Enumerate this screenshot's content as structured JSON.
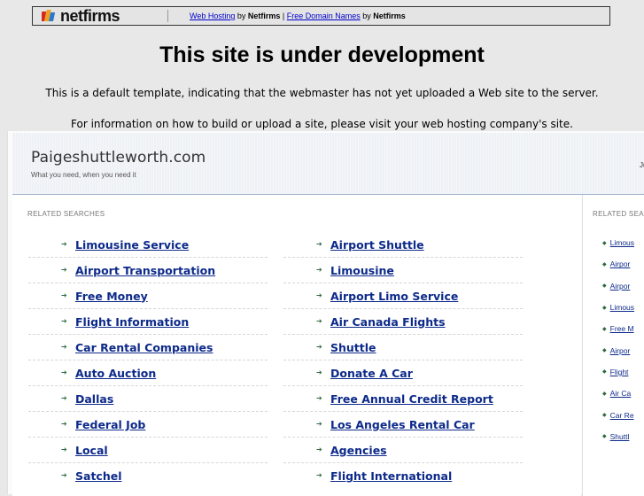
{
  "netfirms_bar": {
    "logo_text": "netfirms",
    "link1": "Web Hosting",
    "by1": " by ",
    "brand1": "Netfirms",
    "separator": " | ",
    "link2": "Free Domain Names",
    "by2": " by ",
    "brand2": "Netfirms"
  },
  "notice": {
    "title": "This site is under development",
    "line1": "This is a default template, indicating that the webmaster has not yet uploaded a Web site to the server.",
    "line2": "For information on how to build or upload a site, please visit your web hosting company's site."
  },
  "site": {
    "name": "Paigeshuttleworth.com",
    "tagline": "What you need, when you need it",
    "header_right": "Ju"
  },
  "main": {
    "section_label": "RELATED SEARCHES",
    "left_links": [
      "Limousine Service",
      "Airport Transportation",
      "Free Money",
      "Flight Information",
      "Car Rental Companies",
      "Auto Auction",
      "Dallas",
      "Federal Job",
      "Local",
      "Satchel"
    ],
    "right_links": [
      "Airport Shuttle",
      "Limousine",
      "Airport Limo Service",
      "Air Canada Flights",
      "Shuttle",
      "Donate A Car",
      "Free Annual Credit Report",
      "Los Angeles Rental Car",
      "Agencies",
      "Flight International"
    ]
  },
  "sidebar": {
    "section_label": "RELATED SEA",
    "links": [
      "Limous",
      "Airpor",
      "Airpor",
      "Limous",
      "Free M",
      "Airpor",
      "Flight",
      "Air Ca",
      "Car Re",
      "Shuttl"
    ]
  },
  "colors": {
    "link": "#0d2a8a",
    "arrow": "#2d6a3e",
    "header_bg": "#eef1f6"
  }
}
